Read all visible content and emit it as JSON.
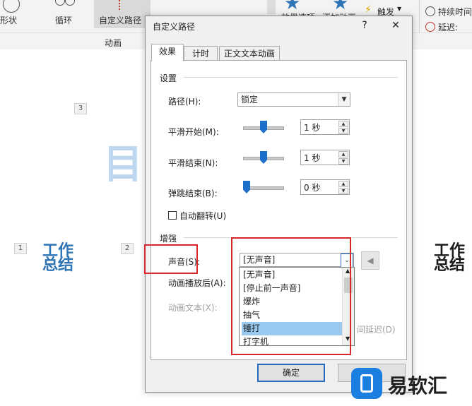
{
  "ribbon": {
    "items": [
      {
        "label": "形状"
      },
      {
        "label": "循环"
      },
      {
        "label": "自定义路径"
      }
    ],
    "group_label": "动画",
    "partial_button_1": "效果选项",
    "partial_button_2": "添加动画",
    "trigger_label": "触发",
    "duration_label": "持续时间",
    "delay_label": "延迟:"
  },
  "slide": {
    "tags": [
      "3",
      "1",
      "2"
    ],
    "ghost_text": "目",
    "wordart_left": "工作总结",
    "wordart_right": "工作总结"
  },
  "dialog": {
    "title": "自定义路径",
    "help_label": "?",
    "close_label": "✕",
    "tabs": [
      {
        "label": "效果",
        "active": true
      },
      {
        "label": "计时",
        "active": false
      },
      {
        "label": "正文文本动画",
        "active": false
      }
    ],
    "settings": {
      "section_title": "设置",
      "path_label": "路径(H):",
      "path_value": "锁定",
      "smooth_start_label": "平滑开始(M):",
      "smooth_start_value": "1 秒",
      "smooth_start_fraction": 0.5,
      "smooth_end_label": "平滑结束(N):",
      "smooth_end_value": "1 秒",
      "smooth_end_fraction": 0.5,
      "bounce_end_label": "弹跳结束(B):",
      "bounce_end_value": "0 秒",
      "bounce_end_fraction": 0.0,
      "auto_reverse_label": "自动翻转(U)",
      "auto_reverse_checked": false
    },
    "enhance": {
      "section_title": "增强",
      "sound_label": "声音(S):",
      "sound_value": "[无声音]",
      "after_anim_label": "动画播放后(A):",
      "anim_text_label": "动画文本(X):",
      "delay_partial": "间延迟(D)",
      "sound_options": [
        "[无声音]",
        "[停止前一声音]",
        "爆炸",
        "抽气",
        "锤打",
        "打字机"
      ],
      "highlighted_option": "锤打"
    },
    "ok_label": "确定"
  },
  "watermark": {
    "text": "易软汇"
  },
  "colors": {
    "accent": "#1e6fc9",
    "highlight": "#99c9ef",
    "annotation_red": "#d9262a"
  }
}
